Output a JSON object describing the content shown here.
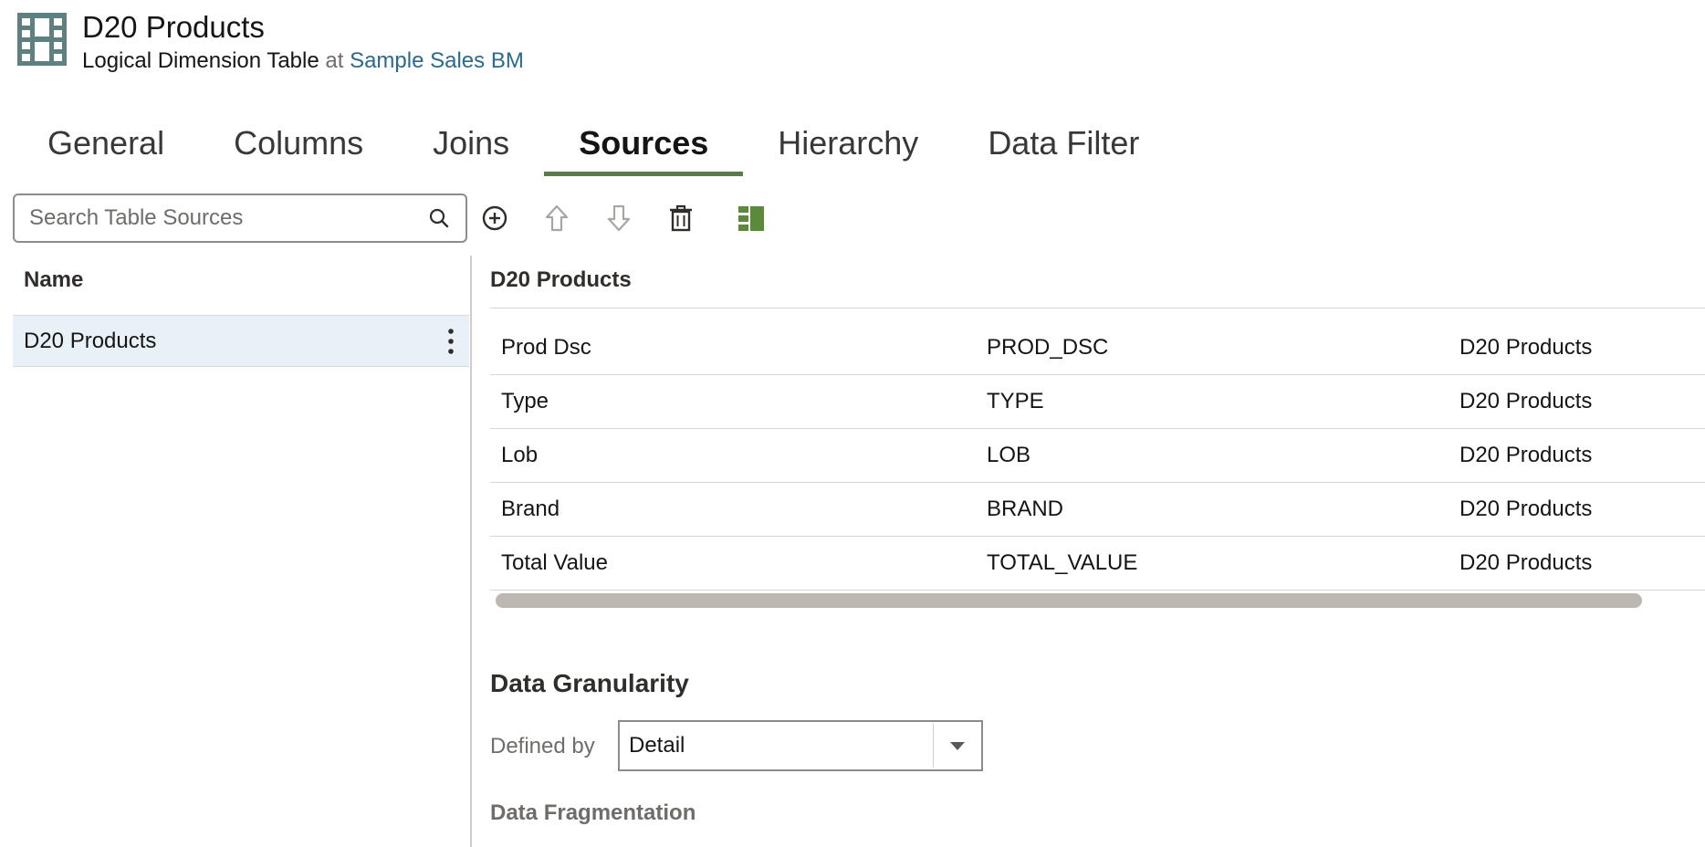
{
  "header": {
    "title": "D20 Products",
    "subtitle_type": "Logical Dimension Table",
    "subtitle_at": "at",
    "subtitle_link": "Sample Sales BM",
    "icon": "table-icon"
  },
  "tabs": [
    {
      "label": "General",
      "active": false
    },
    {
      "label": "Columns",
      "active": false
    },
    {
      "label": "Joins",
      "active": false
    },
    {
      "label": "Sources",
      "active": true
    },
    {
      "label": "Hierarchy",
      "active": false
    },
    {
      "label": "Data Filter",
      "active": false
    }
  ],
  "toolbar": {
    "search_placeholder": "Search Table Sources",
    "buttons": [
      "add-icon",
      "move-up-icon",
      "move-down-icon",
      "delete-icon",
      "panel-toggle-icon"
    ],
    "accent_color": "#5a8a3a"
  },
  "left_panel": {
    "header": "Name",
    "items": [
      {
        "label": "D20 Products",
        "selected": true
      }
    ]
  },
  "right_panel": {
    "title": "D20 Products",
    "rows": [
      {
        "name": "Prod Dsc",
        "physical": "PROD_DSC",
        "source": "D20 Products"
      },
      {
        "name": "Type",
        "physical": "TYPE",
        "source": "D20 Products"
      },
      {
        "name": "Lob",
        "physical": "LOB",
        "source": "D20 Products"
      },
      {
        "name": "Brand",
        "physical": "BRAND",
        "source": "D20 Products"
      },
      {
        "name": "Total Value",
        "physical": "TOTAL_VALUE",
        "source": "D20 Products"
      }
    ],
    "granularity": {
      "title": "Data Granularity",
      "defined_by_label": "Defined by",
      "defined_by_value": "Detail"
    },
    "fragmentation_title": "Data Fragmentation"
  }
}
